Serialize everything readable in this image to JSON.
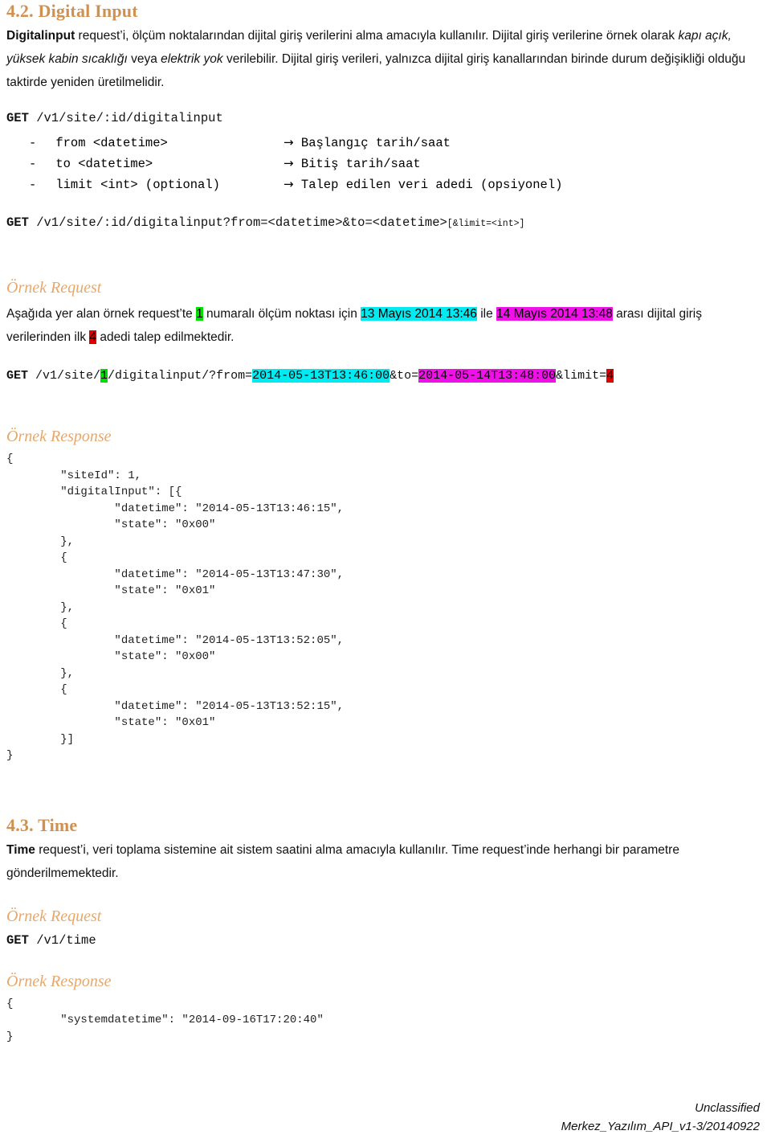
{
  "section_digital_input": {
    "heading": "4.2. Digital Input",
    "intro": {
      "lead_bold": "Digitalinput",
      "t1": " request’i, ölçüm noktalarından dijital giriş verilerini alma amacıyla kullanılır.  Dijital giriş verilerine örnek olarak ",
      "i1": "kapı açık, yüksek kabin sıcaklığı",
      "t2": " veya ",
      "i2": "elektrik yok",
      "t3": " verilebilir. Dijital giriş verileri, yalnızca dijital giriş kanallarından birinde durum değişikliği olduğu taktirde yeniden üretilmelidir."
    },
    "endpoint": {
      "verb": "GET",
      "path": " /v1/site/:id/digitalinput"
    },
    "params": [
      {
        "bullet": "-",
        "name": "from <datetime>",
        "arrow": "→",
        "desc": "Başlangıç tarih/saat"
      },
      {
        "bullet": "-",
        "name": "to <datetime>",
        "arrow": "→",
        "desc": "Bitiş tarih/saat"
      },
      {
        "bullet": "-",
        "name": "limit <int> (optional)",
        "arrow": "→",
        "desc": "Talep edilen veri adedi (opsiyonel)"
      }
    ],
    "endpoint_full": {
      "verb": "GET",
      "path": " /v1/site/:id/digitalinput?from=<datetime>&to=<datetime>",
      "optional": "[&limit=<int>]"
    },
    "sample_request_heading": "Örnek Request",
    "sample_request_desc": {
      "p1_a": "Aşağıda yer alan örnek request’te ",
      "p1_site": "1",
      "p1_b": " numaralı ölçüm noktası için ",
      "p1_from": "13 Mayıs 2014 13:46",
      "p1_c": " ile ",
      "p1_to": "14 Mayıs 2014 13:48",
      "p1_d": " arası dijital giriş verilerinden ilk ",
      "p1_limit": "4",
      "p1_e": " adedi talep edilmektedir."
    },
    "sample_request_line": {
      "verb": "GET",
      "seg1": " /v1/site/",
      "site": "1",
      "seg2": "/digitalinput/?from=",
      "from": "2014-05-13T13:46:00",
      "seg3": "&to=",
      "to": "2014-05-14T13:48:00",
      "seg4": "&limit=",
      "limit": "4"
    },
    "sample_response_heading": "Örnek Response",
    "sample_response_body": "{\n        \"siteId\": 1,\n        \"digitalInput\": [{\n                \"datetime\": \"2014-05-13T13:46:15\",\n                \"state\": \"0x00\"\n        },\n        {\n                \"datetime\": \"2014-05-13T13:47:30\",\n                \"state\": \"0x01\"\n        },\n        {\n                \"datetime\": \"2014-05-13T13:52:05\",\n                \"state\": \"0x00\"\n        },\n        {\n                \"datetime\": \"2014-05-13T13:52:15\",\n                \"state\": \"0x01\"\n        }]\n}"
  },
  "section_time": {
    "heading": "4.3. Time",
    "intro": {
      "lead_bold": "Time",
      "text": " request’i, veri toplama sistemine ait sistem saatini alma amacıyla kullanılır.  Time request’inde herhangi bir parametre gönderilmemektedir."
    },
    "sample_request_heading": "Örnek Request",
    "sample_request_line": {
      "verb": "GET",
      "path": " /v1/time"
    },
    "sample_response_heading": "Örnek Response",
    "sample_response_body": "{\n        \"systemdatetime\": \"2014-09-16T17:20:40\"\n}"
  },
  "footer": {
    "classification": "Unclassified",
    "document_id": "Merkez_Yazılım_API_v1-3/20140922"
  },
  "colors": {
    "heading": "#d09050",
    "sample_heading": "#e8a76a",
    "highlight_green": "#00e000",
    "highlight_cyan": "#00eaf2",
    "highlight_magenta": "#f010e8",
    "highlight_red": "#e00000"
  }
}
